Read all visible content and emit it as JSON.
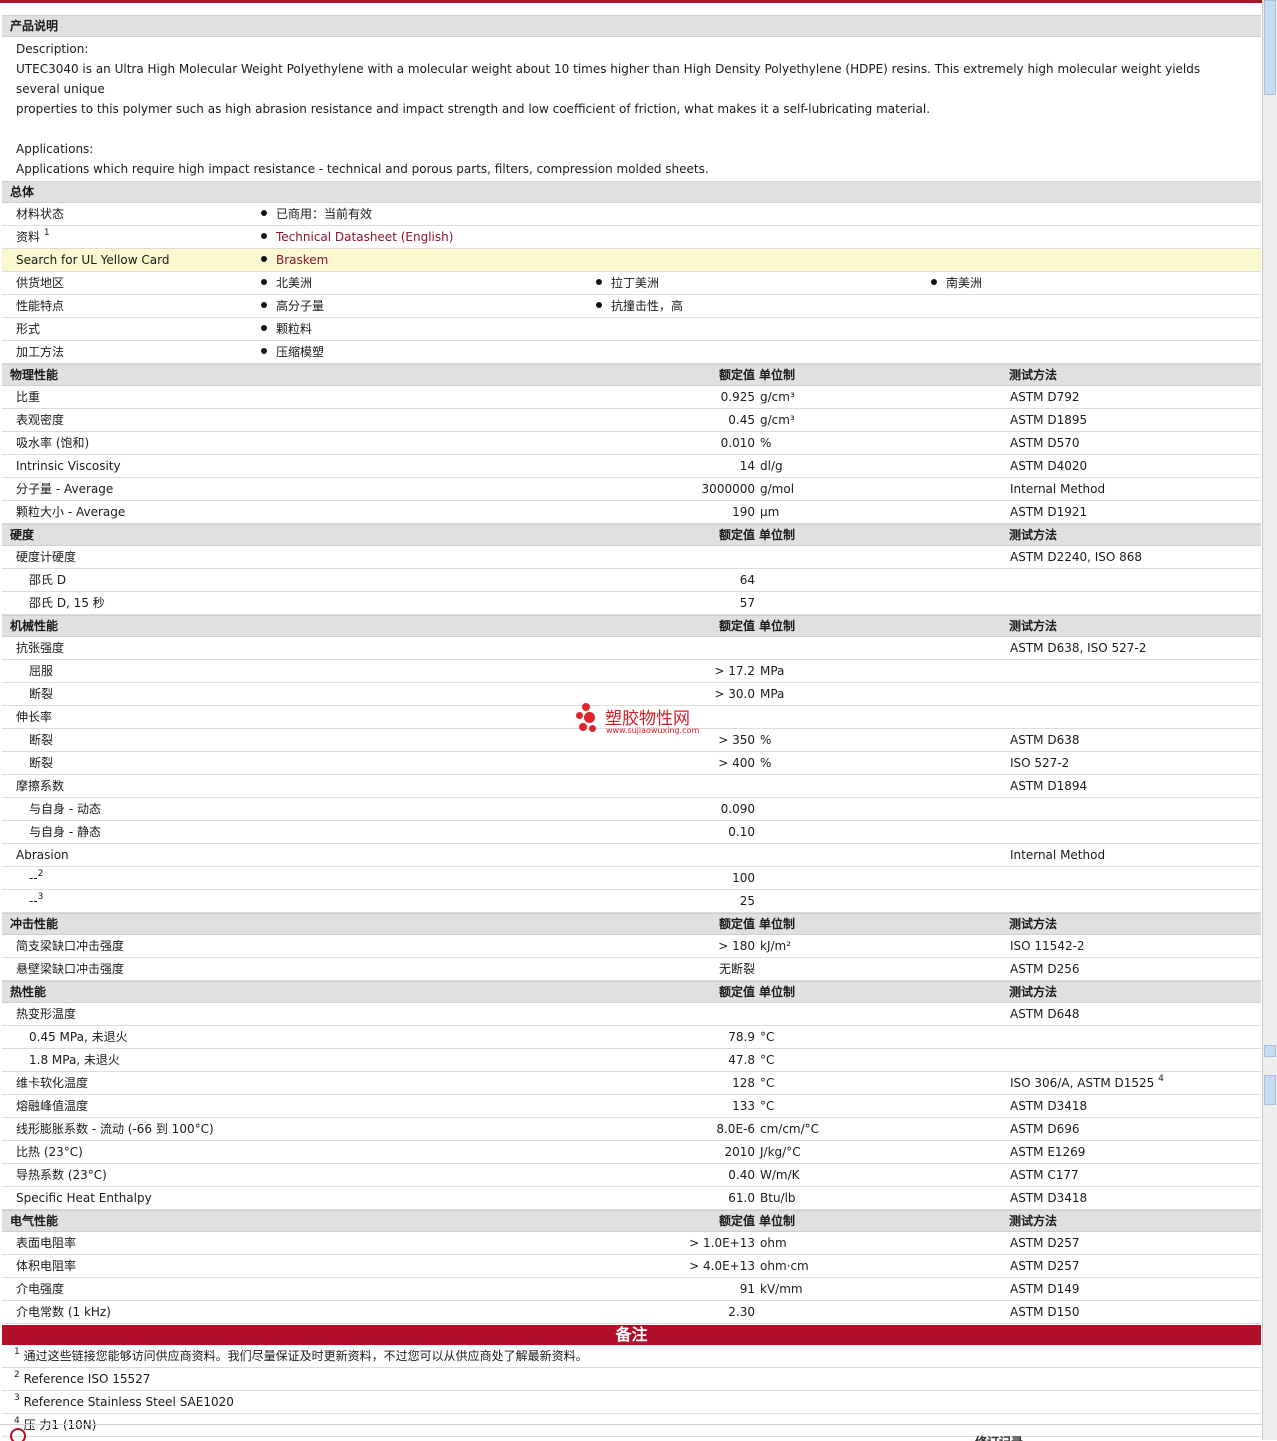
{
  "description_section": {
    "title": "产品说明",
    "lines": [
      "Description:",
      "UTEC3040 is an Ultra High Molecular Weight Polyethylene with a molecular weight about 10 times higher than High Density Polyethylene (HDPE) resins. This extremely high molecular weight yields several unique",
      "properties to this polymer such as high abrasion resistance and impact strength and low coefficient of friction, what makes it a self-lubricating material.",
      "",
      "Applications:",
      "Applications which require high impact resistance - technical and porous parts, filters, compression molded sheets."
    ]
  },
  "general": {
    "title": "总体",
    "rows": [
      {
        "label": "材料状态",
        "items": [
          "已商用：当前有效"
        ],
        "link": false
      },
      {
        "label": "资料",
        "sup": "1",
        "items": [
          "Technical Datasheet (English)"
        ],
        "link": true
      },
      {
        "label": "Search for UL Yellow Card",
        "items": [
          "Braskem"
        ],
        "link": true,
        "highlight": true
      },
      {
        "label": "供货地区",
        "items": [
          "北美洲",
          "拉丁美洲",
          "南美洲"
        ],
        "link": false
      },
      {
        "label": "性能特点",
        "items": [
          "高分子量",
          "抗撞击性，高"
        ],
        "link": false
      },
      {
        "label": "形式",
        "items": [
          "颗粒料"
        ],
        "link": false
      },
      {
        "label": "加工方法",
        "items": [
          "压缩模塑"
        ],
        "link": false
      }
    ]
  },
  "header_labels": {
    "value": "额定值",
    "unit": "单位制",
    "method": "测试方法"
  },
  "property_sections": [
    {
      "title": "物理性能",
      "rows": [
        {
          "p": "比重",
          "v": "0.925",
          "u": "g/cm³",
          "m": "ASTM D792"
        },
        {
          "p": "表观密度",
          "v": "0.45",
          "u": "g/cm³",
          "m": "ASTM D1895"
        },
        {
          "p": "吸水率 (饱和)",
          "v": "0.010",
          "u": "%",
          "m": "ASTM D570"
        },
        {
          "p": "Intrinsic Viscosity",
          "v": "14",
          "u": "dl/g",
          "m": "ASTM D4020"
        },
        {
          "p": "分子量 - Average",
          "v": "3000000",
          "u": "g/mol",
          "m": "Internal Method"
        },
        {
          "p": "颗粒大小 - Average",
          "v": "190",
          "u": "µm",
          "m": "ASTM D1921"
        }
      ]
    },
    {
      "title": "硬度",
      "rows": [
        {
          "p": "硬度计硬度",
          "v": "",
          "u": "",
          "m": "ASTM D2240, ISO 868"
        },
        {
          "p": "邵氏 D",
          "v": "64",
          "u": "",
          "m": "",
          "indent": true
        },
        {
          "p": "邵氏 D, 15 秒",
          "v": "57",
          "u": "",
          "m": "",
          "indent": true
        }
      ]
    },
    {
      "title": "机械性能",
      "rows": [
        {
          "p": "抗张强度",
          "v": "",
          "u": "",
          "m": "ASTM D638, ISO 527-2"
        },
        {
          "p": "屈服",
          "v": "> 17.2",
          "u": "MPa",
          "m": "",
          "indent": true
        },
        {
          "p": "断裂",
          "v": "> 30.0",
          "u": "MPa",
          "m": "",
          "indent": true
        },
        {
          "p": "伸长率",
          "v": "",
          "u": "",
          "m": ""
        },
        {
          "p": "断裂",
          "v": "> 350",
          "u": "%",
          "m": "ASTM D638",
          "indent": true
        },
        {
          "p": "断裂",
          "v": "> 400",
          "u": "%",
          "m": "ISO 527-2",
          "indent": true
        },
        {
          "p": "摩擦系数",
          "v": "",
          "u": "",
          "m": "ASTM D1894"
        },
        {
          "p": "与自身 - 动态",
          "v": "0.090",
          "u": "",
          "m": "",
          "indent": true
        },
        {
          "p": "与自身 - 静态",
          "v": "0.10",
          "u": "",
          "m": "",
          "indent": true
        },
        {
          "p": "Abrasion",
          "v": "",
          "u": "",
          "m": "Internal Method"
        },
        {
          "p": "--",
          "sup": "2",
          "v": "100",
          "u": "",
          "m": "",
          "indent": true
        },
        {
          "p": "--",
          "sup": "3",
          "v": "25",
          "u": "",
          "m": "",
          "indent": true
        }
      ]
    },
    {
      "title": "冲击性能",
      "rows": [
        {
          "p": "简支梁缺口冲击强度",
          "v": "> 180",
          "u": "kJ/m²",
          "m": "ISO 11542-2"
        },
        {
          "p": "悬壁梁缺口冲击强度",
          "v": "无断裂",
          "u": "",
          "m": "ASTM D256"
        }
      ]
    },
    {
      "title": "热性能",
      "rows": [
        {
          "p": "热变形温度",
          "v": "",
          "u": "",
          "m": "ASTM D648"
        },
        {
          "p": "0.45 MPa, 未退火",
          "v": "78.9",
          "u": "°C",
          "m": "",
          "indent": true
        },
        {
          "p": "1.8 MPa, 未退火",
          "v": "47.8",
          "u": "°C",
          "m": "",
          "indent": true
        },
        {
          "p": "维卡软化温度",
          "v": "128",
          "u": "°C",
          "m": "ISO 306/A, ASTM D1525",
          "msup": "4"
        },
        {
          "p": "熔融峰值温度",
          "v": "133",
          "u": "°C",
          "m": "ASTM D3418"
        },
        {
          "p": "线形膨胀系数 - 流动 (-66 到 100°C)",
          "v": "8.0E-6",
          "u": "cm/cm/°C",
          "m": "ASTM D696"
        },
        {
          "p": "比热 (23°C)",
          "v": "2010",
          "u": "J/kg/°C",
          "m": "ASTM E1269"
        },
        {
          "p": "导热系数 (23°C)",
          "v": "0.40",
          "u": "W/m/K",
          "m": "ASTM C177"
        },
        {
          "p": "Specific Heat Enthalpy",
          "v": "61.0",
          "u": "Btu/lb",
          "m": "ASTM D3418"
        }
      ]
    },
    {
      "title": "电气性能",
      "rows": [
        {
          "p": "表面电阻率",
          "v": "> 1.0E+13",
          "u": "ohm",
          "m": "ASTM D257"
        },
        {
          "p": "体积电阻率",
          "v": "> 4.0E+13",
          "u": "ohm·cm",
          "m": "ASTM D257"
        },
        {
          "p": "介电强度",
          "v": "91",
          "u": "kV/mm",
          "m": "ASTM D149"
        },
        {
          "p": "介电常数 (1 kHz)",
          "v": "2.30",
          "u": "",
          "m": "ASTM D150"
        }
      ]
    }
  ],
  "notes": {
    "title": "备注",
    "items": [
      {
        "n": "1",
        "text": "通过这些链接您能够访问供应商资料。我们尽量保证及时更新资料，不过您可以从供应商处了解最新资料。"
      },
      {
        "n": "2",
        "text": "Reference ISO 15527"
      },
      {
        "n": "3",
        "text": "Reference Stainless Steel SAE1020"
      },
      {
        "n": "4",
        "text": "压 力1 (10N)"
      }
    ]
  },
  "watermark": {
    "cn": "塑胶物性网",
    "en": "www.sujiaowuxing.com"
  },
  "footer": {
    "right": "修订记录"
  },
  "colors": {
    "accent": "#b0102a",
    "link": "#8a1530",
    "section_bg": "#e0e0e0",
    "highlight_row": "#fbf7cf"
  }
}
